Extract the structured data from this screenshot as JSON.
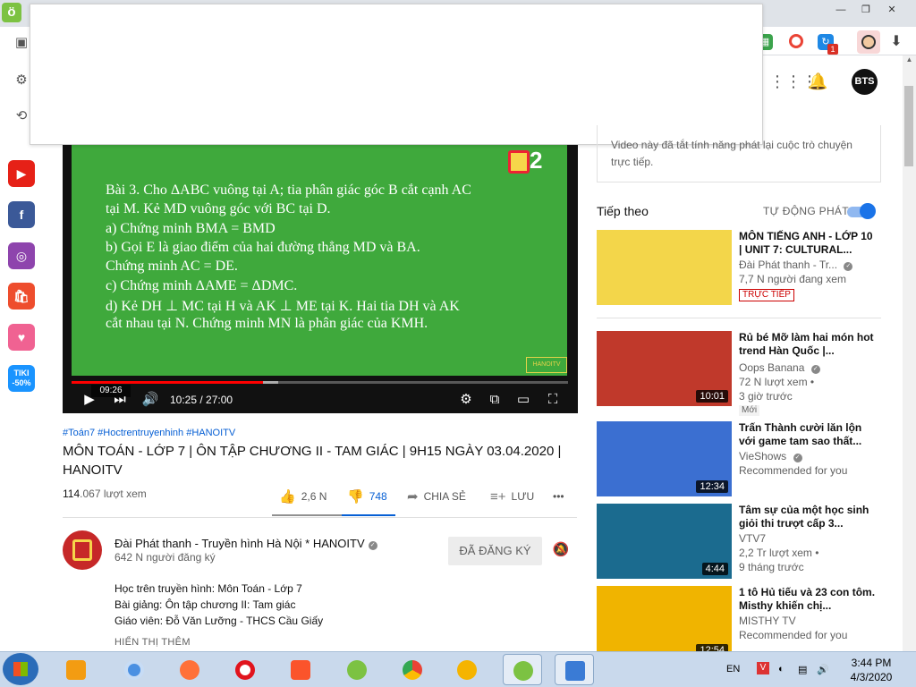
{
  "window": {
    "min": "—",
    "max": "❐",
    "close": "✕"
  },
  "toolbar": {
    "ext_badge": "1",
    "download": "⬇"
  },
  "sidebar": {
    "items": [
      {
        "name": "youtube",
        "label": "▶",
        "color": "#e62117"
      },
      {
        "name": "facebook",
        "label": "f",
        "color": "#3b5998"
      },
      {
        "name": "coccoc",
        "label": "◎",
        "color": "#8e44ad"
      },
      {
        "name": "shopee",
        "label": "🛍",
        "color": "#ee4d2d"
      },
      {
        "name": "heart",
        "label": "♥",
        "color": "#f06292"
      },
      {
        "name": "tiki",
        "label": "TIKI\n-50%",
        "color": "#1a94ff"
      }
    ]
  },
  "player": {
    "board_lines": [
      "Bài 3. Cho ΔABC vuông tại A; tia phân giác góc B cắt cạnh AC",
      "tại M. Kẻ MD vuông góc với BC tại D.",
      "a) Chứng minh BMA = BMD",
      "b) Gọi E là giao điểm của hai đường thẳng MD và BA.",
      "    Chứng minh AC = DE.",
      "c) Chứng minh ΔAME = ΔDMC.",
      "d) Kẻ DH ⊥ MC tại H và AK ⊥ ME tại K. Hai tia DH và AK",
      "    cắt nhau tại N. Chứng minh MN là phân giác của KMH."
    ],
    "logo_num": "2",
    "preview_time": "09:26",
    "time": "10:25 / 27:00",
    "progress_played": 0.386,
    "progress_loaded": 0.416,
    "tag": "HANOITV"
  },
  "video": {
    "hashtags": "#Toán7 #Hoctrentruyenhinh #HANOITV",
    "title": "MÔN TOÁN - LỚP 7 | ÔN TẬP CHƯƠNG II - TAM GIÁC | 9H15 NGÀY 03.04.2020 | HANOITV",
    "views_bold": "114",
    "views_rest": ".067 lượt xem",
    "likes": "2,6 N",
    "dislikes": "748",
    "share": "CHIA SẺ",
    "save": "LƯU",
    "more": "•••"
  },
  "channel": {
    "name": "Đài Phát thanh - Truyền hình Hà Nội * HANOITV",
    "subs": "642 N người đăng ký",
    "subscribe": "ĐÃ ĐĂNG KÝ",
    "desc": [
      "Học trên truyền hình: Môn Toán - Lớp 7",
      "Bài giảng: Ôn tập chương II: Tam giác",
      "Giáo viên: Đỗ Văn Lưỡng - THCS Cầu Giấy"
    ],
    "show_more": "HIỂN THỊ THÊM"
  },
  "sidepanel": {
    "chat_text": "Video này đã tắt tính năng phát lại cuộc trò chuyện trực tiếp.",
    "up_next": "Tiếp theo",
    "autoplay": "TỰ ĐỘNG PHÁT",
    "autoplay_on": true
  },
  "recommendations": [
    {
      "title": "MÔN TIẾNG ANH - LỚP 10 | UNIT 7: CULTURAL...",
      "channel": "Đài Phát thanh - Tr...",
      "meta1": "7,7 N người đang xem",
      "meta2": "",
      "badge": "TRỰC TIẾP",
      "duration": "",
      "thumb": "#f3d64a"
    },
    {
      "title": "Rủ bé Mỡ làm hai món hot trend Hàn Quốc |...",
      "channel": "Oops Banana",
      "meta1": "72 N lượt xem •",
      "meta2": "3 giờ trước",
      "badge": "Mới",
      "duration": "10:01",
      "thumb": "#c0392b"
    },
    {
      "title": "Trấn Thành cười lăn lộn với game tam sao thất...",
      "channel": "VieShows",
      "meta1": "Recommended for you",
      "meta2": "",
      "badge": "",
      "duration": "12:34",
      "thumb": "#3b6fd1"
    },
    {
      "title": "Tâm sự của một học sinh giỏi thi trượt cấp 3...",
      "channel": "VTV7",
      "meta1": "2,2 Tr lượt xem •",
      "meta2": "9 tháng trước",
      "badge": "",
      "duration": "4:44",
      "thumb": "#1b6b8f"
    },
    {
      "title": "1 tô Hủ tiếu và 23 con tôm. Misthy khiến chị...",
      "channel": "MISTHY TV",
      "meta1": "Recommended for you",
      "meta2": "",
      "badge": "",
      "duration": "12:54",
      "thumb": "#f0b400"
    }
  ],
  "taskbar": {
    "lang": "EN",
    "time": "3:44 PM",
    "date": "4/3/2020"
  }
}
